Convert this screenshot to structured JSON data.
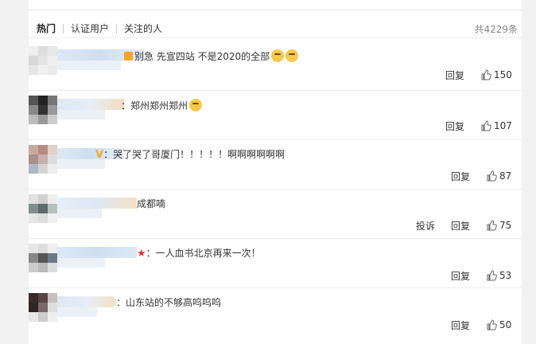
{
  "tabs": [
    "热门",
    "认证用户",
    "关注的人"
  ],
  "total": "共4229条",
  "actions": {
    "reply": "回复",
    "report": "投诉"
  },
  "comments": [
    {
      "text": "别急 先宣四站 不是2020的全部",
      "likes": "150"
    },
    {
      "text": "：郑州郑州郑州",
      "likes": "107"
    },
    {
      "text": "：哭了哭了哥厦门！！！！！啊啊啊啊啊啊",
      "likes": "87"
    },
    {
      "text": "成都喃",
      "likes": "75"
    },
    {
      "text": "：一人血书北京再来一次！",
      "likes": "53"
    },
    {
      "text": "：山东站的不够高呜呜呜",
      "likes": "50"
    }
  ],
  "colors": {
    "accent": "#f5a623",
    "text": "#333333",
    "muted": "#888888",
    "divider": "#eeeeee"
  }
}
